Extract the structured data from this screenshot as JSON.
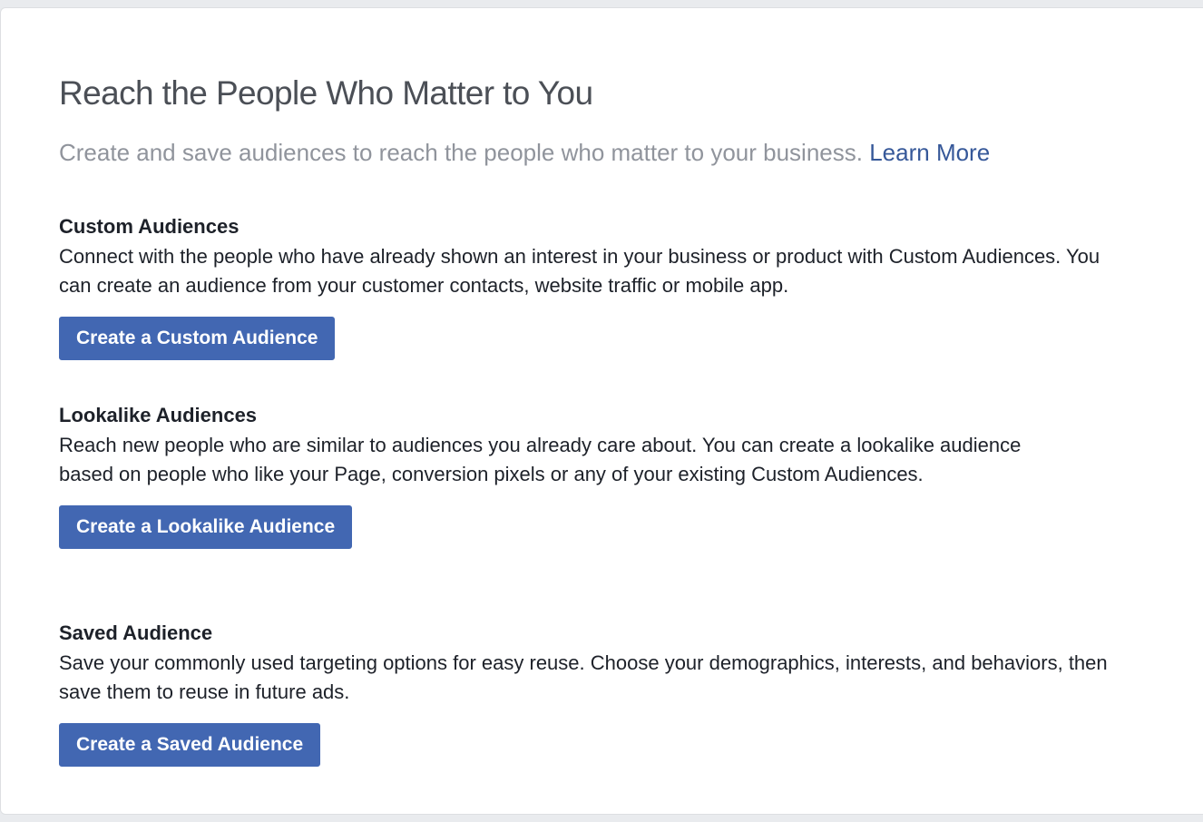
{
  "header": {
    "title": "Reach the People Who Matter to You",
    "subtitle": "Create and save audiences to reach the people who matter to your business.",
    "learn_more": "Learn More"
  },
  "sections": [
    {
      "title": "Custom Audiences",
      "description": "Connect with the people who have already shown an interest in your business or product with Custom Audiences. You can create an audience from your customer contacts, website traffic or mobile app.",
      "button": "Create a Custom Audience"
    },
    {
      "title": "Lookalike Audiences",
      "description": "Reach new people who are similar to audiences you already care about. You can create a lookalike audience based on people who like your Page, conversion pixels or any of your existing Custom Audiences.",
      "button": "Create a Lookalike Audience"
    },
    {
      "title": "Saved Audience",
      "description": "Save your commonly used targeting options for easy reuse. Choose your demographics, interests, and behaviors, then save them to reuse in future ads.",
      "button": "Create a Saved Audience"
    }
  ],
  "colors": {
    "button_blue": "#4267b2",
    "link_blue": "#365899",
    "title_gray": "#4b4f56",
    "subtitle_gray": "#90949c",
    "text_dark": "#1d2129",
    "page_background": "#e9ebee"
  }
}
